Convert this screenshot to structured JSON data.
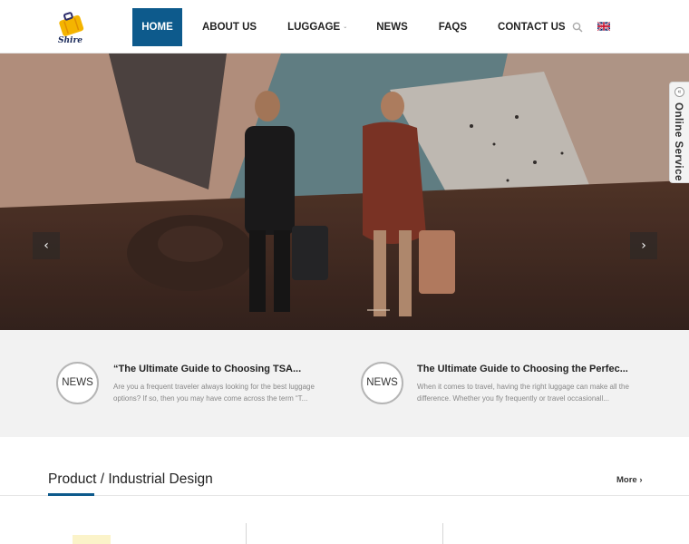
{
  "brand": {
    "logo_text": "Shire"
  },
  "nav": {
    "items": [
      {
        "label": "HOME",
        "active": true
      },
      {
        "label": "ABOUT US",
        "active": false
      },
      {
        "label": "LUGGAGE",
        "active": false,
        "has_dropdown": true
      },
      {
        "label": "NEWS",
        "active": false
      },
      {
        "label": "FAQS",
        "active": false
      },
      {
        "label": "CONTACT US",
        "active": false
      }
    ],
    "dropdown_caret": "⌄",
    "search_icon": "search-icon",
    "language_icon": "uk-flag-icon"
  },
  "hero": {
    "prev_arrow": "‹",
    "next_arrow": "›"
  },
  "online_service": {
    "label": "Online Service",
    "toggle": "«"
  },
  "news": [
    {
      "badge": "NEWS",
      "title": "“The Ultimate Guide to Choosing TSA...",
      "desc": "Are you a frequent traveler always looking for the best luggage options? If so, then you may have come across the term “T..."
    },
    {
      "badge": "NEWS",
      "title": "The Ultimate Guide to Choosing the Perfec...",
      "desc": "When it comes to travel, having the right luggage can make all the difference. Whether you fly frequently or travel occasionall..."
    }
  ],
  "products": {
    "title": "Product / Industrial Design",
    "more": "More"
  },
  "colors": {
    "accent": "#0d5a8c",
    "news_band": "#f2f2f2"
  }
}
